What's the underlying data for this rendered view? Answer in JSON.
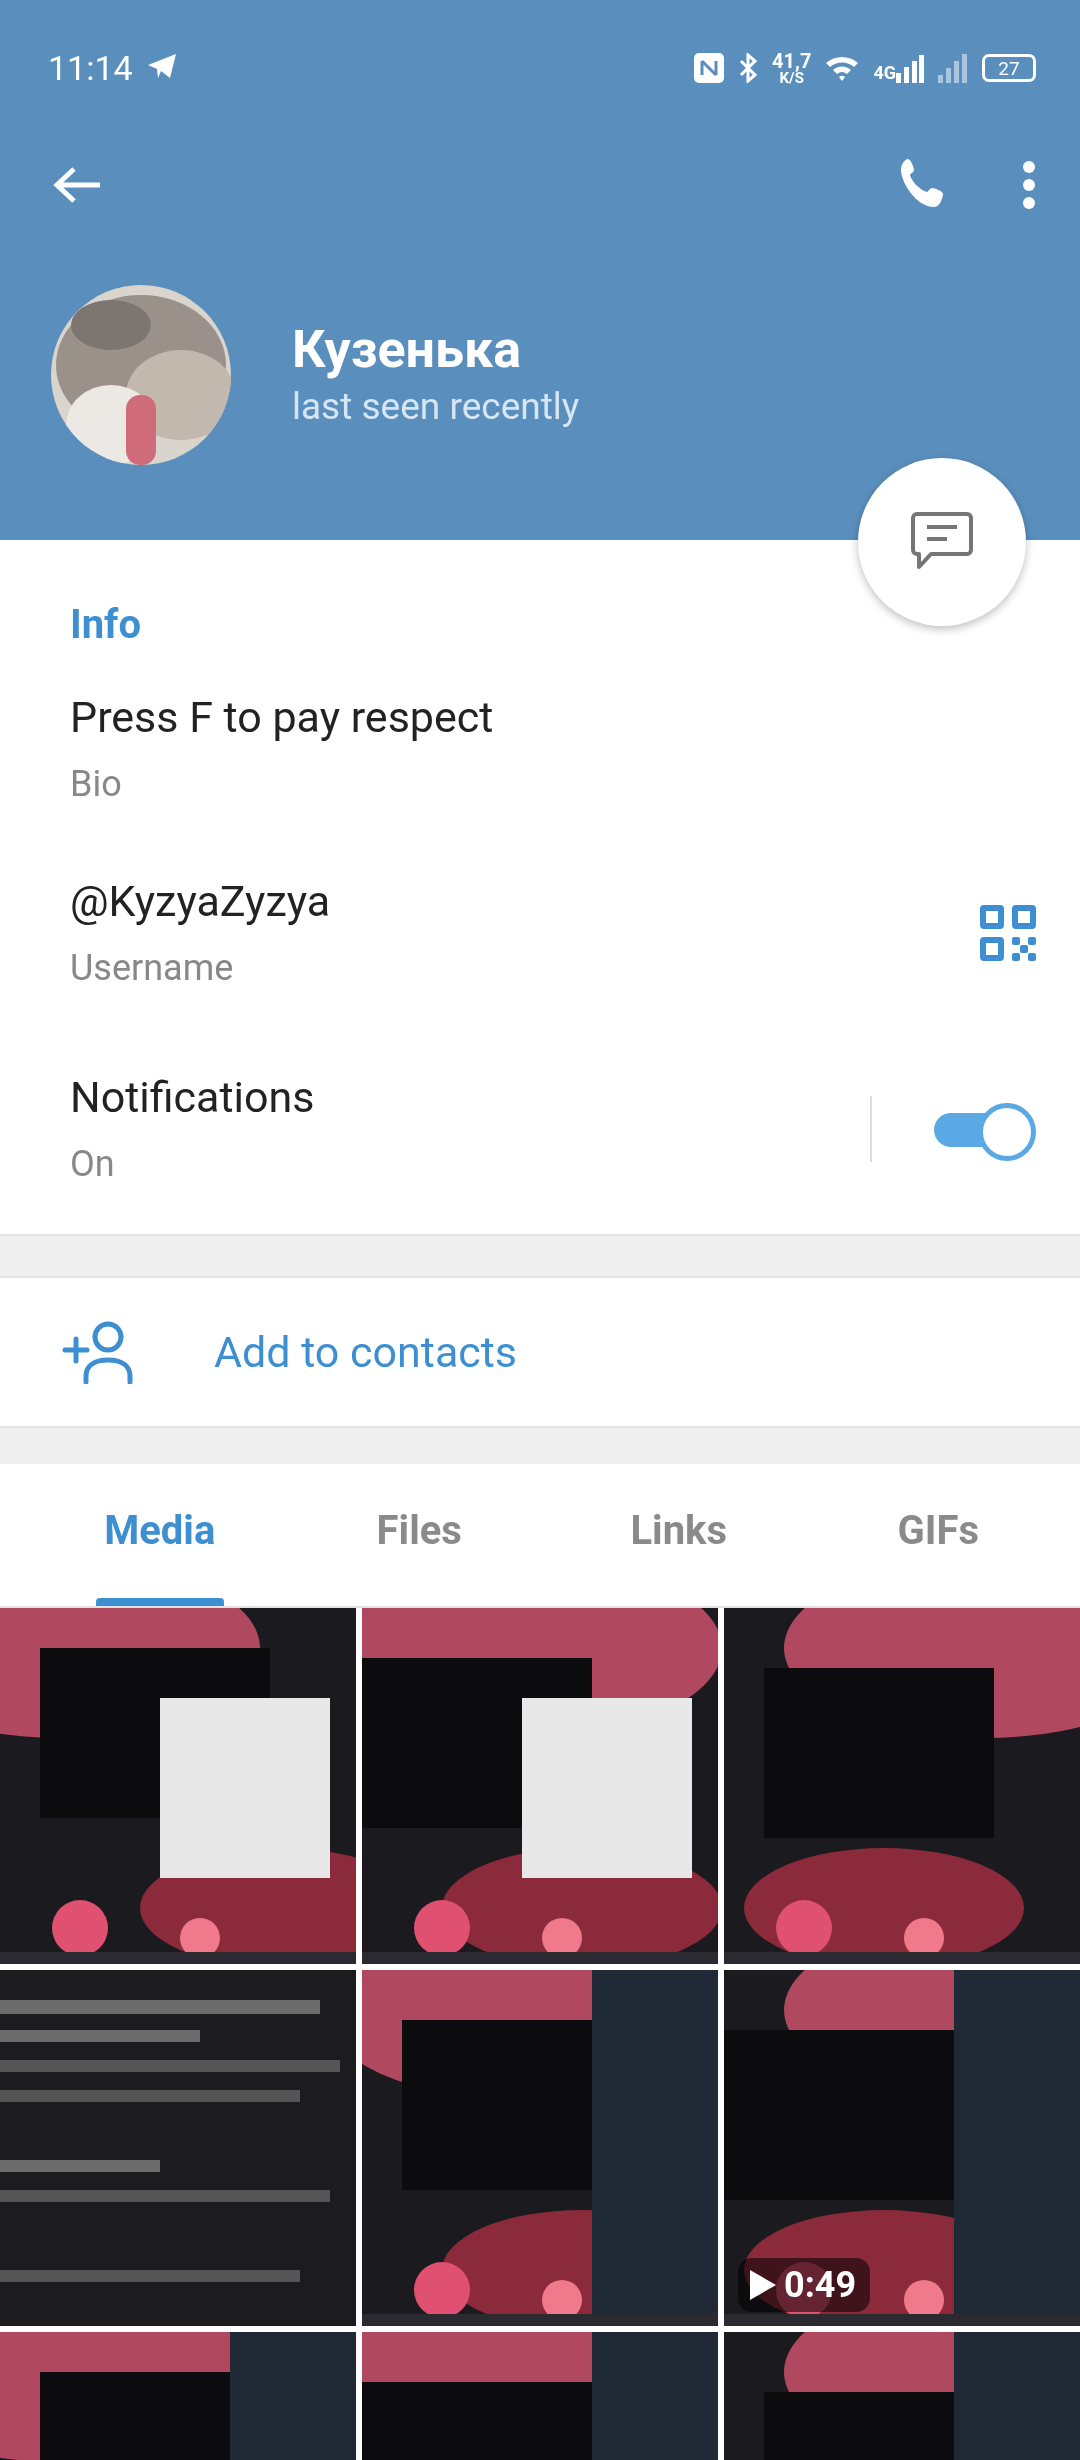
{
  "status_bar": {
    "time": "11:14",
    "network_speed": "41,7",
    "speed_unit": "K/S",
    "network_type": "4G",
    "battery": "27"
  },
  "profile": {
    "name": "Кузенька",
    "status": "last seen recently"
  },
  "info": {
    "heading": "Info",
    "rows": [
      {
        "kind": "text",
        "value": "Press F to pay respect",
        "label": "Bio"
      },
      {
        "kind": "qr",
        "value": "@KyzyaZyzya",
        "label": "Username"
      },
      {
        "kind": "toggle",
        "value": "Notifications",
        "label": "On",
        "on": true
      }
    ]
  },
  "actions": [
    {
      "kind": "add_contact",
      "label": "Add to contacts"
    }
  ],
  "tabs": [
    {
      "label": "Media",
      "selected": true
    },
    {
      "label": "Files",
      "selected": false
    },
    {
      "label": "Links",
      "selected": false
    },
    {
      "label": "GIFs",
      "selected": false
    }
  ],
  "media": [
    {
      "kind": "picture"
    },
    {
      "kind": "picture"
    },
    {
      "kind": "picture"
    },
    {
      "kind": "picture"
    },
    {
      "kind": "picture"
    },
    {
      "kind": "video",
      "duration": "0:49"
    },
    {
      "kind": "picture"
    },
    {
      "kind": "picture"
    },
    {
      "kind": "picture"
    }
  ]
}
